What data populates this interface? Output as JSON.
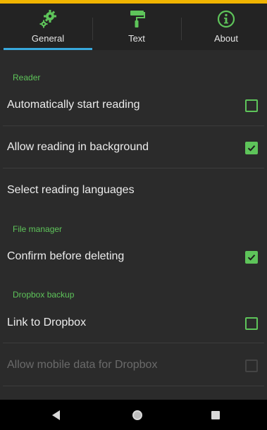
{
  "tabs": [
    {
      "label": "General",
      "icon": "gears-icon",
      "selected": true
    },
    {
      "label": "Text",
      "icon": "paint-roller-icon",
      "selected": false
    },
    {
      "label": "About",
      "icon": "info-icon",
      "selected": false
    }
  ],
  "sections": {
    "reader": "Reader",
    "file_manager": "File manager",
    "dropbox": "Dropbox backup"
  },
  "settings": {
    "auto_start": {
      "label": "Automatically start reading",
      "checked": false
    },
    "background": {
      "label": "Allow reading in background",
      "checked": true
    },
    "languages": {
      "label": "Select reading languages"
    },
    "confirm_delete": {
      "label": "Confirm before deleting",
      "checked": true
    },
    "link_dropbox": {
      "label": "Link to Dropbox",
      "checked": false
    },
    "mobile_data": {
      "label": "Allow mobile data for Dropbox",
      "checked": false,
      "enabled": false
    }
  },
  "colors": {
    "accent": "#5ec45a",
    "tab_indicator": "#38a8dd",
    "status_bar": "#f0b400",
    "background": "#2b2b2b"
  },
  "navbar": {
    "icons": [
      "back-icon",
      "home-icon",
      "recents-icon"
    ]
  }
}
